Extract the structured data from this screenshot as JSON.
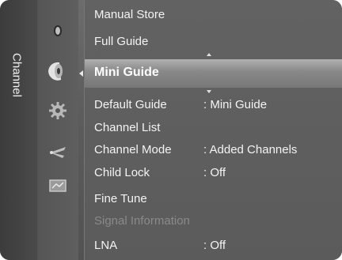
{
  "sidebar": {
    "title": "Channel",
    "icons": [
      "picture-icon",
      "sound-icon",
      "channel-icon",
      "setup-icon",
      "input-icon",
      "application-icon"
    ],
    "selected_icon": "channel-icon"
  },
  "menu": {
    "items": [
      {
        "label": "Manual Store",
        "value": ""
      },
      {
        "label": "Full Guide",
        "value": ""
      },
      {
        "label": "Mini Guide",
        "value": "",
        "selected": true
      },
      {
        "label": "Default Guide",
        "value": ": Mini Guide"
      },
      {
        "label": "Channel List",
        "value": ""
      },
      {
        "label": "Channel Mode",
        "value": ": Added Channels"
      },
      {
        "label": "Child Lock",
        "value": ": Off"
      },
      {
        "label": "Fine Tune",
        "value": ""
      },
      {
        "label": "Signal Information",
        "value": "",
        "disabled": true
      },
      {
        "label": "LNA",
        "value": ": Off"
      }
    ]
  },
  "colors": {
    "background": "#5e5e5e",
    "highlight": "#9a9a9a",
    "text": "#f4f4f4",
    "disabled_text": "#8a8a8a"
  }
}
